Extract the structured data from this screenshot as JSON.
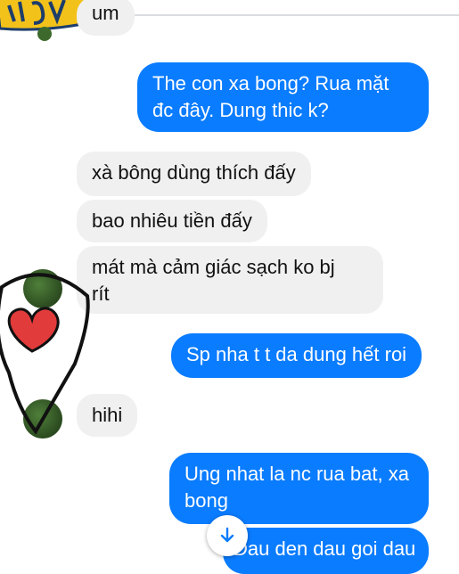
{
  "messages": [
    {
      "side": "in",
      "text": "um"
    },
    {
      "side": "out",
      "line1": "The con xa bong? Rua mặt",
      "line2": "đc đây. Dung thic k?"
    },
    {
      "side": "in",
      "text": "xà bông dùng thích đấy"
    },
    {
      "side": "in",
      "text": "bao nhiêu tiền đấy"
    },
    {
      "side": "in",
      "line1": "mát mà cảm giác sạch ko bj",
      "line2": "rít"
    },
    {
      "side": "out",
      "text": "Sp nha t t da dung hết roi"
    },
    {
      "side": "in",
      "text": "hihi"
    },
    {
      "side": "out",
      "line1": "Ung nhat la nc rua bat, xa",
      "line2": "bong"
    },
    {
      "side": "out",
      "text": "Dau den dau goi dau"
    }
  ],
  "icons": {
    "scroll_down": "arrow-down-icon",
    "heart": "heart-icon",
    "sticker": "sticker-icon"
  },
  "colors": {
    "outgoing_bubble": "#0a7cff",
    "incoming_bubble": "#f0f0f1",
    "heart": "#e23b3b",
    "scroll_arrow": "#0a7cff"
  }
}
